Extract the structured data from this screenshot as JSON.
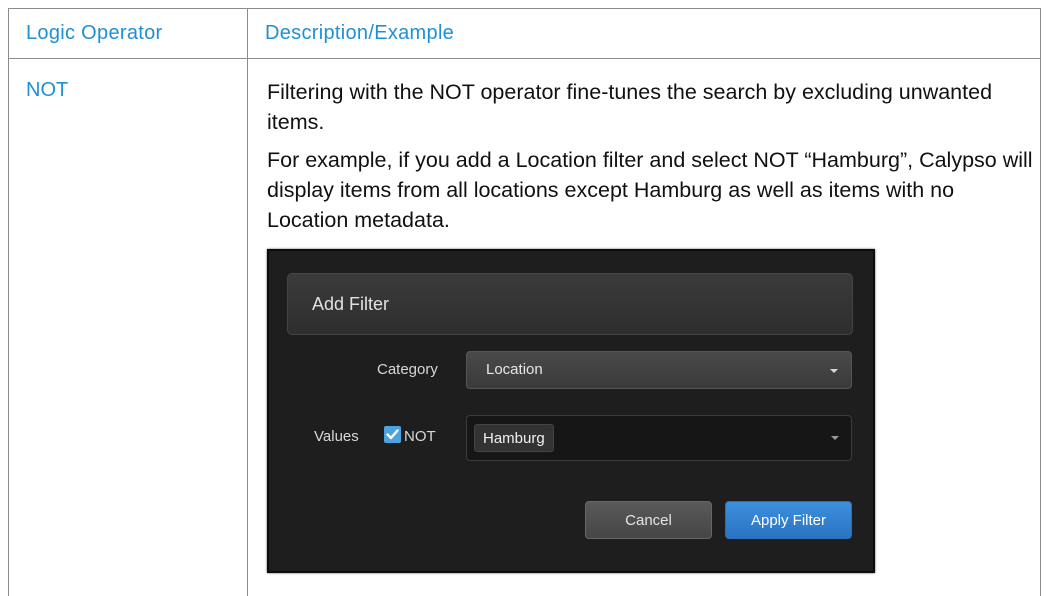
{
  "table": {
    "headers": [
      "Logic Operator",
      "Description/Example"
    ],
    "row": {
      "operator": "NOT",
      "paragraph_1": "Filtering with the NOT operator fine-tunes the search by excluding unwanted items.",
      "paragraph_2": "For example, if you add a Location filter and select NOT “Hamburg”, Calypso will display items from all locations except Hamburg as well as items with no Location metadata."
    }
  },
  "dialog": {
    "title": "Add Filter",
    "category_label": "Category",
    "category_value": "Location",
    "values_label": "Values",
    "not_label": "NOT",
    "not_checked": true,
    "selected_tag": "Hamburg",
    "cancel_label": "Cancel",
    "apply_label": "Apply Filter"
  },
  "colors": {
    "header_text": "#1f8fd6",
    "dialog_background": "#1e1e1e",
    "apply_button": "#3d8fdc"
  }
}
